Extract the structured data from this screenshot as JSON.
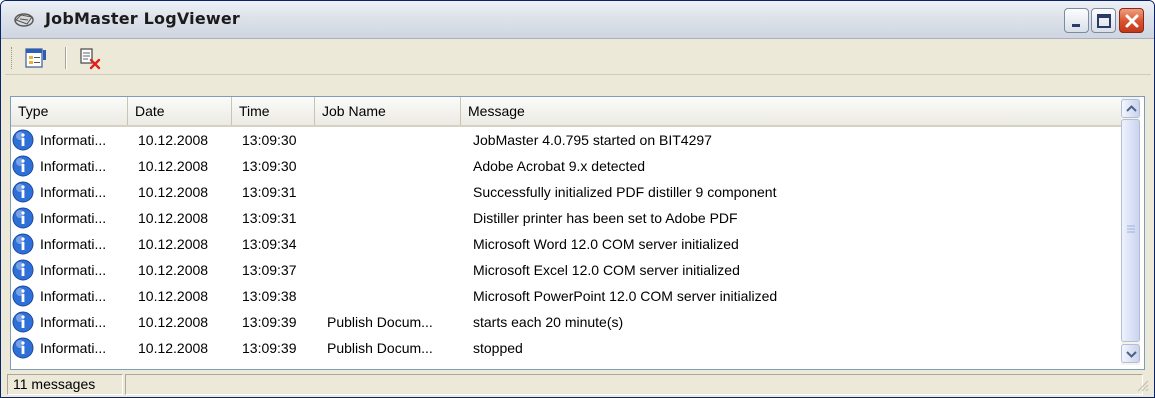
{
  "window": {
    "title": "JobMaster LogViewer",
    "title_icon": "log-viewer-icon",
    "controls": [
      "minimize-icon",
      "maximize-icon",
      "close-icon"
    ]
  },
  "toolbar": {
    "buttons": [
      {
        "name": "properties-button",
        "icon": "properties-icon"
      },
      {
        "name": "clear-log-button",
        "icon": "clear-log-icon"
      }
    ]
  },
  "log_list": {
    "columns": [
      "Type",
      "Date",
      "Time",
      "Job Name",
      "Message"
    ],
    "rows": [
      {
        "type": "Informati...",
        "date": "10.12.2008",
        "time": "13:09:30",
        "job": "",
        "message": "JobMaster 4.0.795 started on BIT4297"
      },
      {
        "type": "Informati...",
        "date": "10.12.2008",
        "time": "13:09:30",
        "job": "",
        "message": "Adobe Acrobat 9.x detected"
      },
      {
        "type": "Informati...",
        "date": "10.12.2008",
        "time": "13:09:31",
        "job": "",
        "message": "Successfully initialized PDF distiller 9 component"
      },
      {
        "type": "Informati...",
        "date": "10.12.2008",
        "time": "13:09:31",
        "job": "",
        "message": "Distiller printer has been set to Adobe PDF"
      },
      {
        "type": "Informati...",
        "date": "10.12.2008",
        "time": "13:09:34",
        "job": "",
        "message": "Microsoft Word 12.0 COM server initialized"
      },
      {
        "type": "Informati...",
        "date": "10.12.2008",
        "time": "13:09:37",
        "job": "",
        "message": "Microsoft Excel 12.0 COM server initialized"
      },
      {
        "type": "Informati...",
        "date": "10.12.2008",
        "time": "13:09:38",
        "job": "",
        "message": "Microsoft PowerPoint 12.0 COM server initialized"
      },
      {
        "type": "Informati...",
        "date": "10.12.2008",
        "time": "13:09:39",
        "job": "Publish Docum...",
        "message": "starts each 20 minute(s)"
      },
      {
        "type": "Informati...",
        "date": "10.12.2008",
        "time": "13:09:39",
        "job": "Publish Docum...",
        "message": "stopped"
      }
    ],
    "row_icon": "information-icon"
  },
  "status": {
    "message_count": "11 messages"
  },
  "colors": {
    "info_icon": "#2f6fd8",
    "close_button": "#d9512f",
    "list_border": "#7f9db9"
  }
}
